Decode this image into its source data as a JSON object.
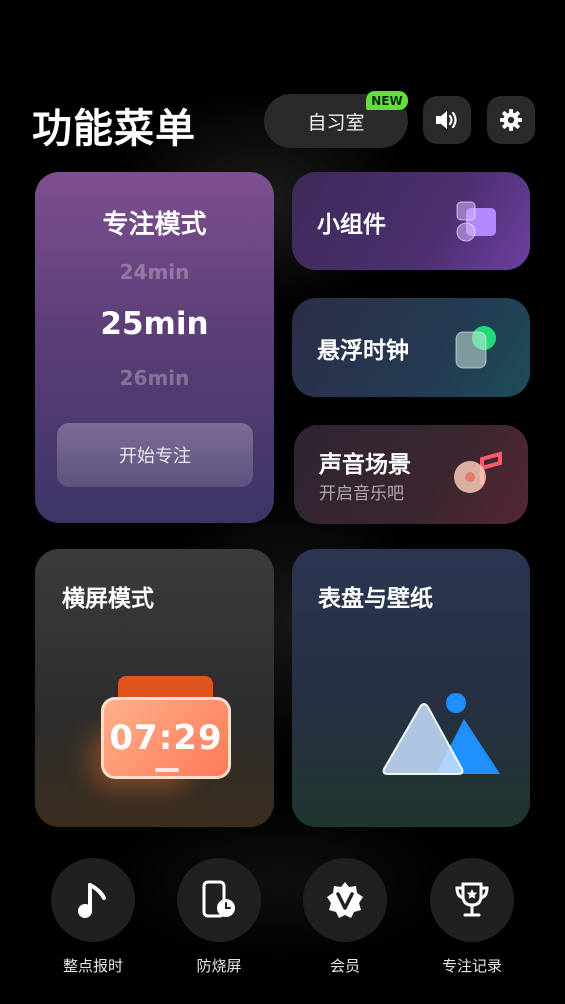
{
  "header": {
    "title": "功能菜单",
    "study_room_label": "自习室",
    "new_badge": "NEW"
  },
  "focus": {
    "title": "专注模式",
    "time_prev": "24min",
    "time_current": "25min",
    "time_next": "26min",
    "start_label": "开始专注"
  },
  "widgets": {
    "label": "小组件"
  },
  "floating_clock": {
    "label": "悬浮时钟"
  },
  "sound_scene": {
    "label": "声音场景",
    "subtitle": "开启音乐吧"
  },
  "landscape": {
    "label": "横屏模式",
    "clock_time": "07:29"
  },
  "dial_wallpaper": {
    "label": "表盘与壁纸"
  },
  "bottom_bar": {
    "hourly_chime": "整点报时",
    "burn_in": "防烧屏",
    "member": "会员",
    "focus_record": "专注记录"
  },
  "icons": [
    "speaker-icon",
    "gear-icon",
    "widget-icon",
    "floating-clock-icon",
    "music-note-icon",
    "image-icon",
    "note-icon",
    "phone-clock-icon",
    "vip-badge-icon",
    "trophy-icon"
  ],
  "colors": {
    "accent_new": "#5fe03a",
    "focus_purple": "#7e4f8f",
    "image_blue": "#1e90ff"
  }
}
